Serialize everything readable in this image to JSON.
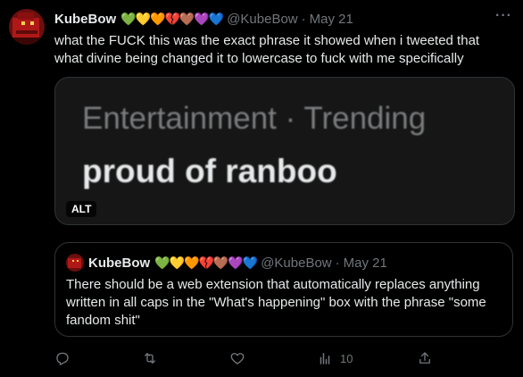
{
  "tweet": {
    "display_name": "KubeBow",
    "hearts": "💚💛🧡💔🤎💜💙",
    "handle": "@KubeBow",
    "separator": "·",
    "date": "May 21",
    "text": "what the FUCK this was the exact phrase it showed when i tweeted that what divine being changed it to lowercase to fuck with me specifically",
    "media": {
      "line1": "Entertainment · Trending",
      "line2": "proud of ranboo",
      "alt_badge": "ALT"
    }
  },
  "quote": {
    "display_name": "KubeBow",
    "hearts": "💚💛🧡💔🤎💜💙",
    "handle": "@KubeBow",
    "separator": "·",
    "date": "May 21",
    "text": "There should be a web extension that automatically replaces anything written in all caps in the \"What's happening\" box with the phrase \"some fandom shit\""
  },
  "actions": {
    "views_count": "10"
  },
  "colors": {
    "background": "#000000",
    "text": "#e7e9ea",
    "muted": "#71767b",
    "border": "#2f3336"
  }
}
